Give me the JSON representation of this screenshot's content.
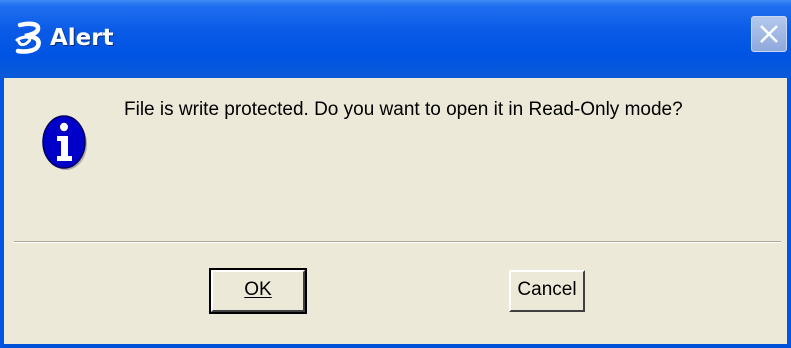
{
  "window": {
    "title": "Alert",
    "close_label": "Close"
  },
  "message": {
    "text": "File is write protected. Do you want to open it in Read-Only mode?",
    "icon": "information-icon"
  },
  "buttons": {
    "ok_label": "OK",
    "cancel_label": "Cancel"
  },
  "colors": {
    "titlebar": "#0054e3",
    "dialog_background": "#ece9d8",
    "icon_blue": "#0000c8"
  }
}
